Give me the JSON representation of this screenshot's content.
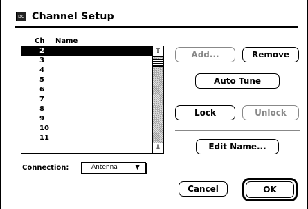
{
  "dialog": {
    "title": "Channel Setup",
    "icon_name": "tv-app-icon",
    "icon_text": "DC"
  },
  "channel_list": {
    "headers": [
      "Ch",
      "Name"
    ],
    "items": [
      "2",
      "3",
      "4",
      "5",
      "6",
      "7",
      "8",
      "9",
      "10",
      "11"
    ],
    "selected_index": 0,
    "scroll_up_glyph": "⇧",
    "scroll_down_glyph": "⇩"
  },
  "connection": {
    "label": "Connection:",
    "selected": "Antenna",
    "caret": "▼"
  },
  "buttons": {
    "add": "Add...",
    "remove": "Remove",
    "auto_tune": "Auto Tune",
    "lock": "Lock",
    "unlock": "Unlock",
    "edit_name": "Edit Name...",
    "cancel": "Cancel",
    "ok": "OK"
  }
}
